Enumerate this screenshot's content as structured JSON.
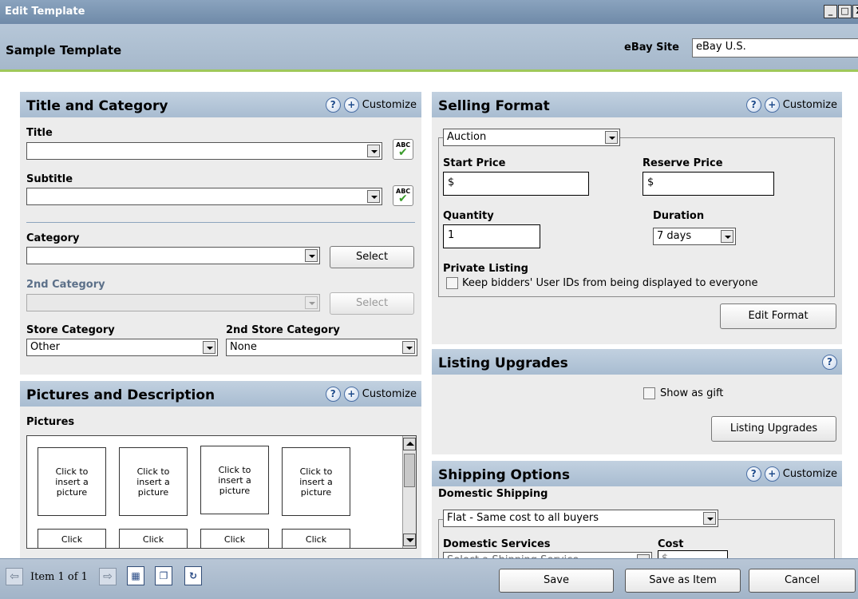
{
  "window": {
    "title": "Edit Template",
    "min": "_",
    "max": "□",
    "close": "X"
  },
  "template": {
    "name": "Sample Template",
    "site_label": "eBay Site",
    "site_value": "eBay U.S."
  },
  "title_category": {
    "header": "Title and Category",
    "customize": "Customize",
    "title_label": "Title",
    "subtitle_label": "Subtitle",
    "category_label": "Category",
    "category_select": "Select",
    "second_category_label": "2nd Category",
    "second_category_select": "Select",
    "store_category_label": "Store Category",
    "store_category_value": "Other",
    "second_store_category_label": "2nd Store Category",
    "second_store_category_value": "None",
    "spell_text": "ABC"
  },
  "pictures": {
    "header": "Pictures and Description",
    "customize": "Customize",
    "pictures_label": "Pictures",
    "slots": [
      "Click to insert a picture",
      "Click to insert a picture",
      "Click to insert a picture",
      "Click to insert a picture"
    ],
    "partial_slots": [
      "Click",
      "Click",
      "Click",
      "Click"
    ]
  },
  "selling_format": {
    "header": "Selling Format",
    "customize": "Customize",
    "format_value": "Auction",
    "start_price_label": "Start Price",
    "start_price_value": "$",
    "reserve_price_label": "Reserve Price",
    "reserve_price_value": "$",
    "quantity_label": "Quantity",
    "quantity_value": "1",
    "duration_label": "Duration",
    "duration_value": "7 days",
    "private_listing_label": "Private Listing",
    "private_listing_checkbox": "Keep bidders' User IDs from being displayed to everyone",
    "edit_format_button": "Edit Format"
  },
  "listing_upgrades": {
    "header": "Listing Upgrades",
    "show_as_gift": "Show as gift",
    "button": "Listing Upgrades"
  },
  "shipping": {
    "header": "Shipping Options",
    "customize": "Customize",
    "domestic_label": "Domestic Shipping",
    "domestic_value": "Flat - Same cost to all  buyers",
    "services_label": "Domestic Services",
    "cost_label": "Cost",
    "services_value": "Select a Shipping Service",
    "cost_value": "$"
  },
  "footer": {
    "item_text": "Item 1 of 1",
    "save": "Save",
    "save_as_item": "Save as Item",
    "cancel": "Cancel"
  }
}
